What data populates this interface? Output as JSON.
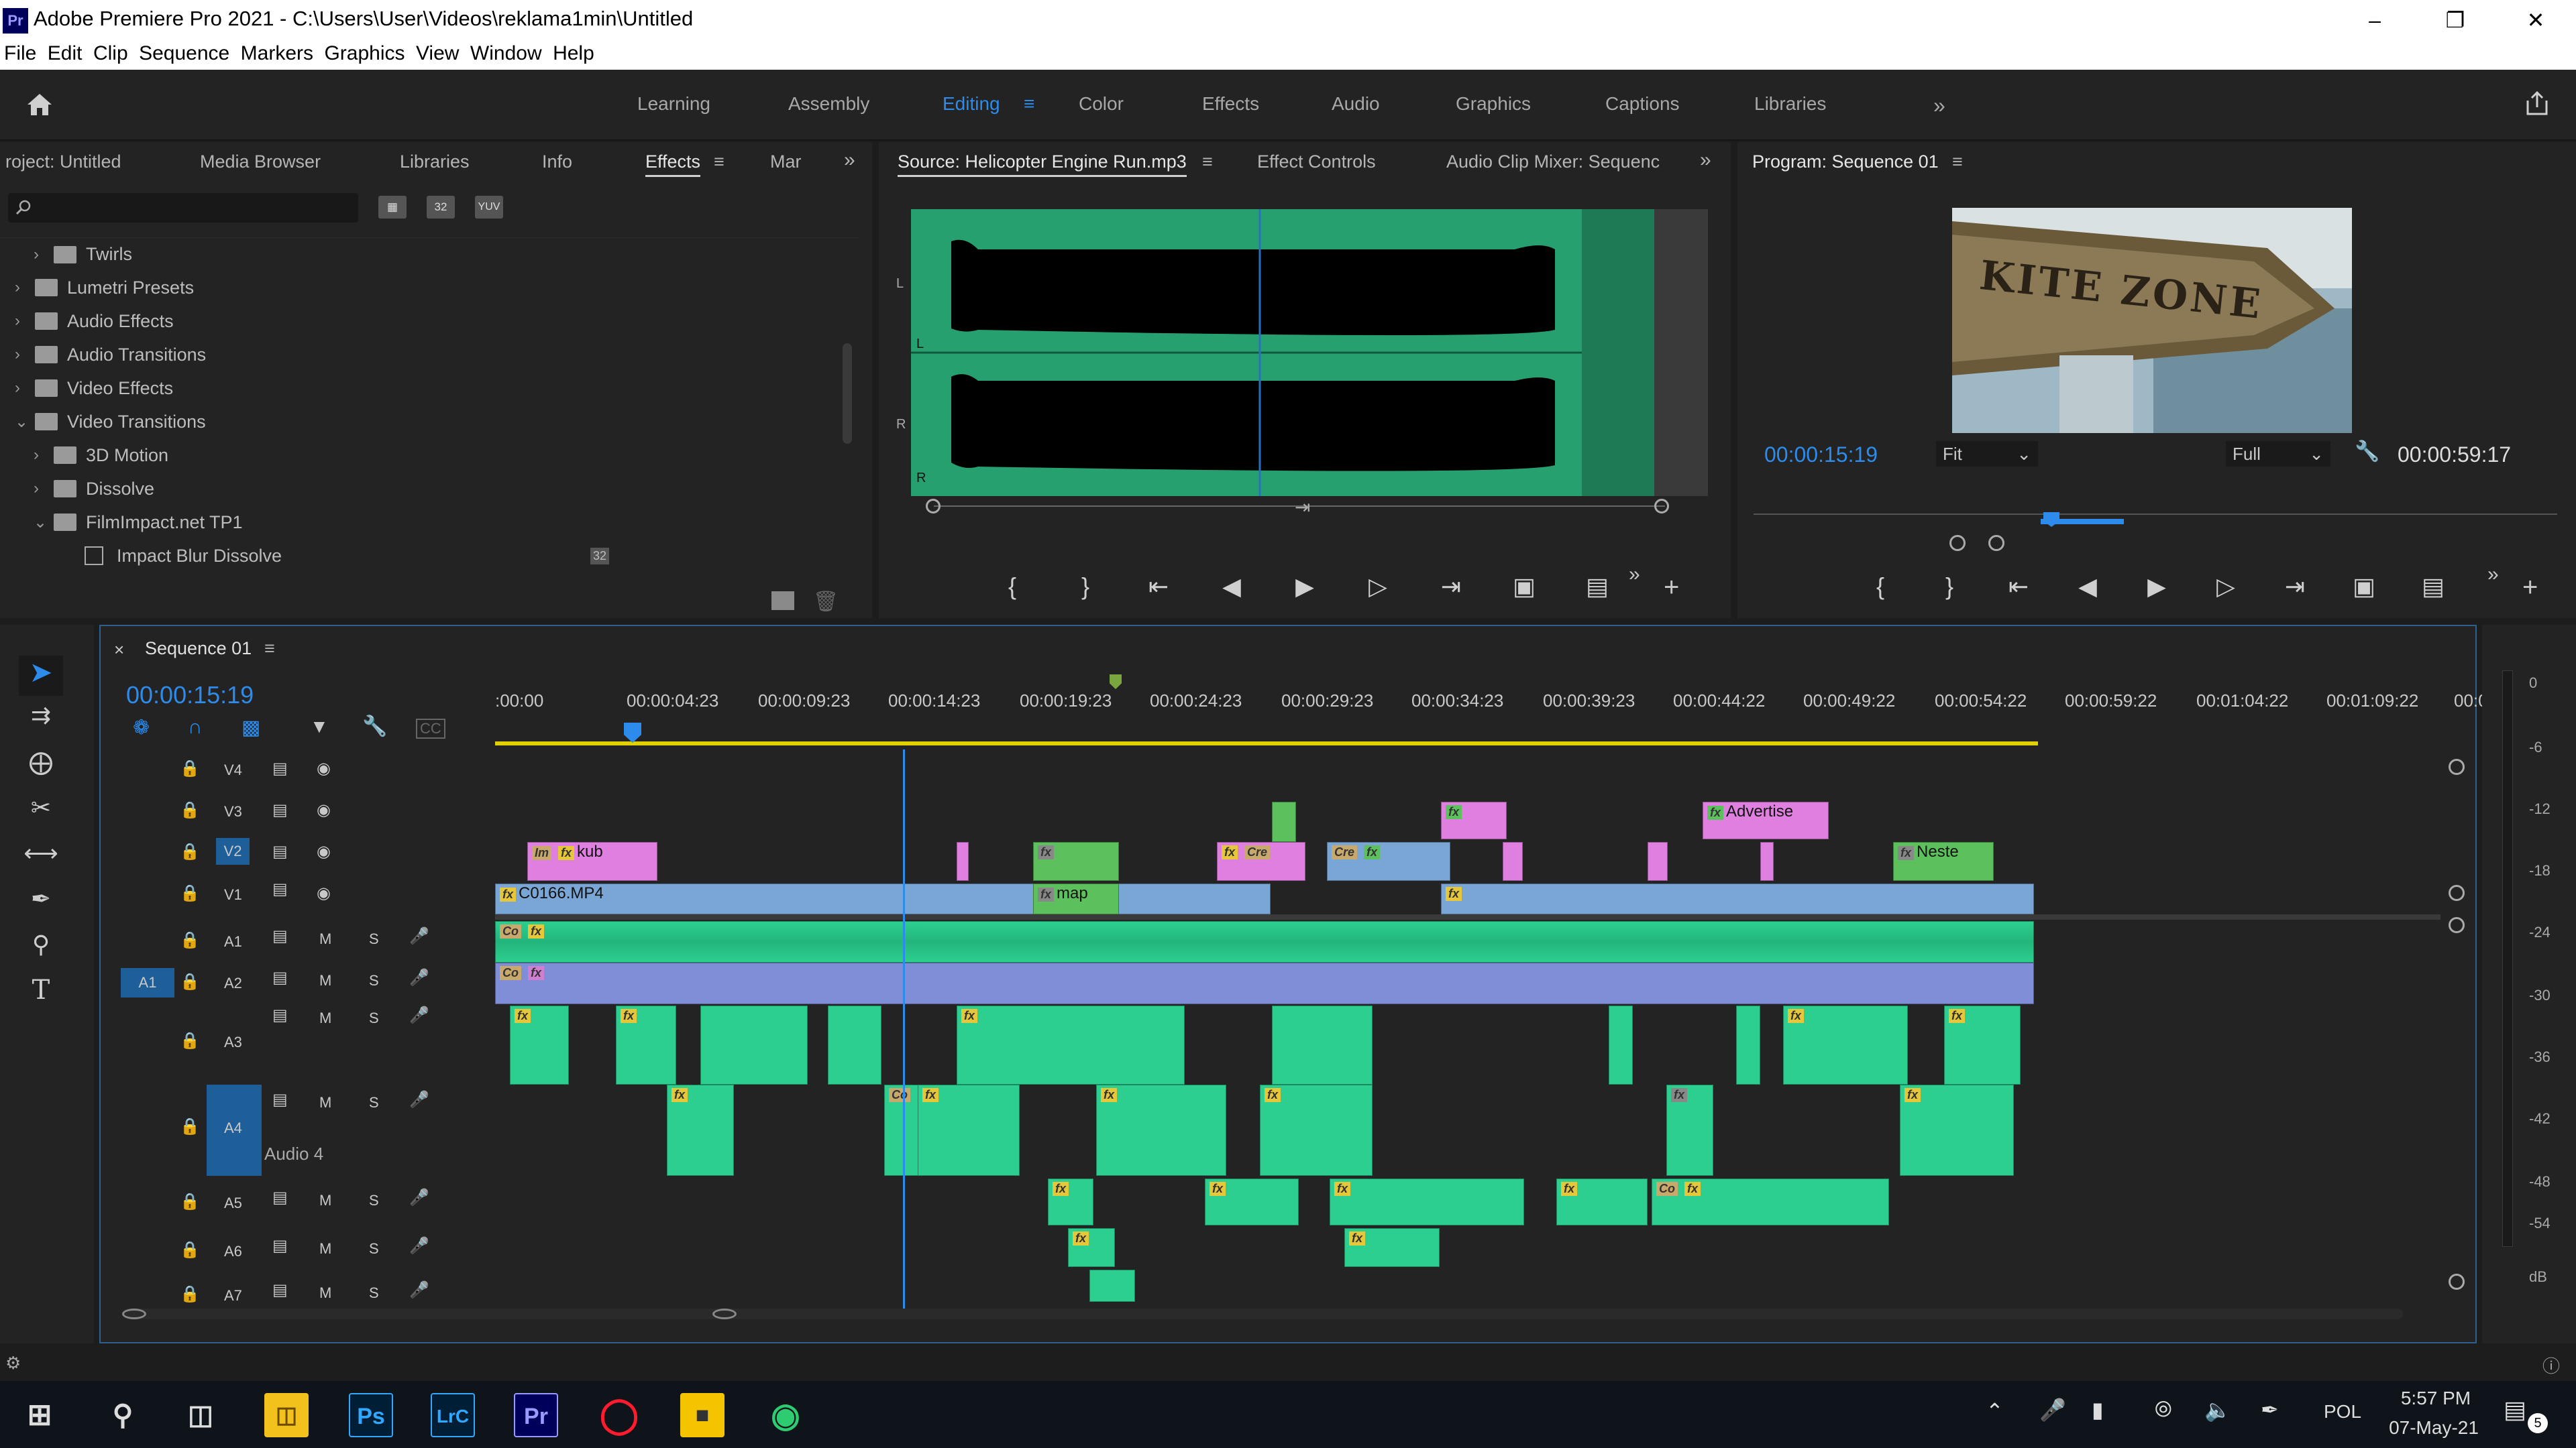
{
  "window": {
    "title": "Adobe Premiere Pro 2021 - C:\\Users\\User\\Videos\\reklama1min\\Untitled",
    "app_badge": "Pr"
  },
  "menu": [
    "File",
    "Edit",
    "Clip",
    "Sequence",
    "Markers",
    "Graphics",
    "View",
    "Window",
    "Help"
  ],
  "workspaces": [
    "Learning",
    "Assembly",
    "Editing",
    "Color",
    "Effects",
    "Audio",
    "Graphics",
    "Captions",
    "Libraries"
  ],
  "active_workspace": "Editing",
  "project_panel": {
    "tabs": [
      "roject: Untitled",
      "Media Browser",
      "Libraries",
      "Info",
      "Effects",
      "Mar"
    ],
    "active_tab": "Effects",
    "icons": [
      "32",
      "32",
      "YUV"
    ],
    "tree": [
      {
        "label": "Twirls",
        "level": 1,
        "expanded": false
      },
      {
        "label": "Lumetri Presets",
        "level": 0,
        "expanded": false
      },
      {
        "label": "Audio Effects",
        "level": 0,
        "expanded": false
      },
      {
        "label": "Audio Transitions",
        "level": 0,
        "expanded": false
      },
      {
        "label": "Video Effects",
        "level": 0,
        "expanded": false
      },
      {
        "label": "Video Transitions",
        "level": 0,
        "expanded": true
      },
      {
        "label": "3D Motion",
        "level": 1,
        "expanded": false
      },
      {
        "label": "Dissolve",
        "level": 1,
        "expanded": false
      },
      {
        "label": "FilmImpact.net TP1",
        "level": 1,
        "expanded": true
      },
      {
        "label": "Impact Blur Dissolve",
        "level": 2,
        "item": true
      }
    ]
  },
  "source_panel": {
    "tabs": [
      "Source: Helicopter Engine Run.mp3",
      "Effect Controls",
      "Audio Clip Mixer: Sequenc"
    ],
    "channel_labels": [
      "L",
      "L",
      "R",
      "R"
    ]
  },
  "program_panel": {
    "title": "Program: Sequence 01",
    "timecode": "00:00:15:19",
    "fit": "Fit",
    "quality": "Full",
    "duration": "00:00:59:17",
    "thumbnail_text": "KITE ZONE"
  },
  "timeline": {
    "sequence": "Sequence 01",
    "timecode": "00:00:15:19",
    "ruler": [
      ":00:00",
      "00:00:04:23",
      "00:00:09:23",
      "00:00:14:23",
      "00:00:19:23",
      "00:00:24:23",
      "00:00:29:23",
      "00:00:34:23",
      "00:00:39:23",
      "00:00:44:22",
      "00:00:49:22",
      "00:00:54:22",
      "00:00:59:22",
      "00:01:04:22",
      "00:01:09:22",
      "00:01:"
    ],
    "video_tracks": [
      "V4",
      "V3",
      "V2",
      "V1"
    ],
    "audio_tracks": [
      "A1",
      "A2",
      "A3",
      "A4",
      "A5",
      "A6",
      "A7"
    ],
    "track_target": "A1",
    "audio4_name": "Audio 4",
    "clips": {
      "kub": "kub",
      "c0166": "C0166.MP4",
      "map": "map",
      "advertise": "Advertise",
      "neste": "Neste",
      "im": "Im",
      "cr": "Cre",
      "co": "Co"
    },
    "track_buttons": {
      "mute": "M",
      "solo": "S"
    }
  },
  "meter_scale": [
    "0",
    "-6",
    "-12",
    "-18",
    "-24",
    "-30",
    "-36",
    "-42",
    "-48",
    "-54",
    "dB"
  ],
  "taskbar": {
    "apps": [
      "Ps",
      "LrC",
      "Pr"
    ],
    "lang": "POL",
    "time": "5:57 PM",
    "date": "07-May-21",
    "notif_count": "5"
  }
}
